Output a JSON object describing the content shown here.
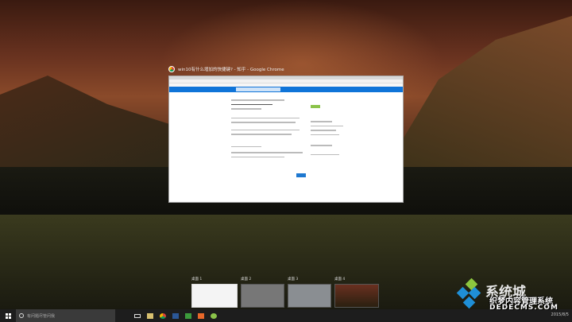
{
  "window": {
    "title": "win10有什么增加的快捷键? - 知乎 - Google Chrome"
  },
  "desktops": [
    {
      "label": "桌面 1"
    },
    {
      "label": "桌面 2"
    },
    {
      "label": "桌面 3"
    },
    {
      "label": "桌面 4"
    }
  ],
  "taskbar": {
    "search_placeholder": "有问题尽管问我",
    "apps": [
      {
        "name": "file-explorer",
        "color": "#d8c070"
      },
      {
        "name": "chrome",
        "color": "#db4437"
      },
      {
        "name": "word",
        "color": "#2b5797"
      },
      {
        "name": "spreadsheet",
        "color": "#3c9a3c"
      },
      {
        "name": "media",
        "color": "#e8682a"
      },
      {
        "name": "android",
        "color": "#8bc34a"
      }
    ],
    "clock": "2015/8/5"
  },
  "watermark": {
    "title": "系统城",
    "subtitle": "织梦内容管理系统",
    "domain": "DEDECMS.COM"
  },
  "colors": {
    "accent": "#0f74d8",
    "follow": "#8bc34a"
  }
}
